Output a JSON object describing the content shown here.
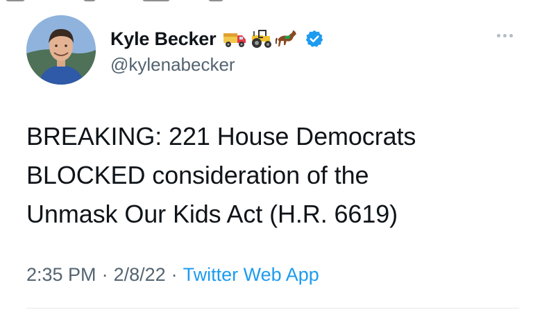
{
  "tweet": {
    "author": {
      "display_name": "Kyle Becker",
      "name_emojis": [
        "truck-emoji",
        "tractor-emoji",
        "horse-emoji"
      ],
      "verified": true,
      "handle": "@kylenabecker"
    },
    "text": "BREAKING: 221 House Democrats\nBLOCKED consideration of the\nUnmask Our Kids Act (H.R. 6619)",
    "time": "2:35 PM",
    "separator": "·",
    "date": "2/8/22",
    "source": "Twitter Web App",
    "more_icon": "more-horizontal-icon"
  },
  "colors": {
    "text_primary": "#0f1419",
    "text_secondary": "#536471",
    "link": "#1d9bf0",
    "verified": "#1d9bf0",
    "divider": "#e4e8eb"
  }
}
